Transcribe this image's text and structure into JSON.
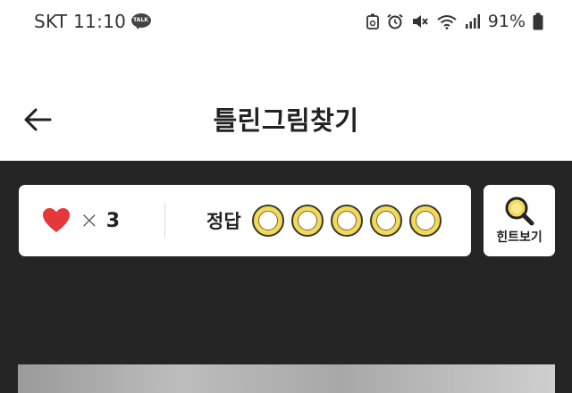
{
  "status_bar": {
    "carrier_time": "SKT 11:10",
    "talk_badge": "TALK",
    "battery_percent": "91%",
    "icons": [
      "recycle-icon",
      "alarm-icon",
      "mute-icon",
      "wifi-icon",
      "signal-icon",
      "battery-icon"
    ]
  },
  "header": {
    "title": "틀린그림찾기",
    "back_icon": "back-arrow-icon"
  },
  "game": {
    "lives_count": "3",
    "lives_times": "×",
    "answer_label": "정답",
    "answer_slots": 5,
    "answers_found": 0,
    "hint_label": "힌트보기"
  },
  "colors": {
    "heart": "#e5383b",
    "slot_fill": "#f2d95a",
    "background": "#252525",
    "card": "#ffffff"
  }
}
